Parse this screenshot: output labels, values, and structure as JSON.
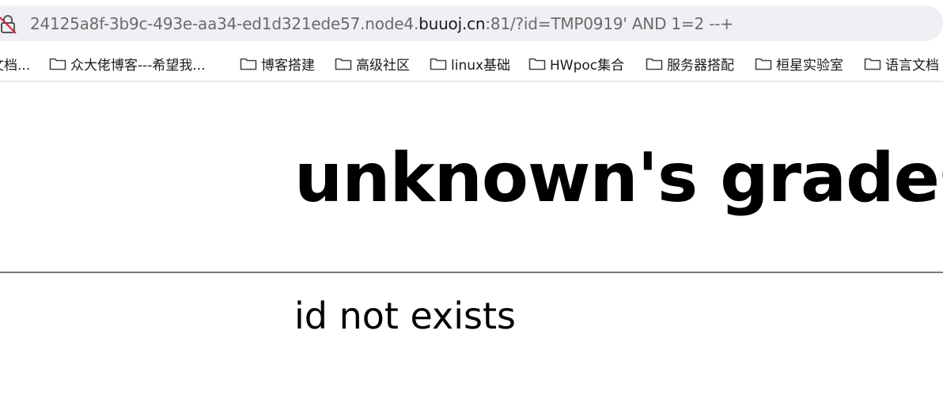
{
  "browser": {
    "url_prefix": "24125a8f-3b9c-493e-aa34-ed1d321ede57.node4.",
    "url_domain": "buuoj.cn",
    "url_suffix": ":81/?id=TMP0919' AND 1=2 --+",
    "lock_icon": "insecure-lock-icon"
  },
  "bookmarks": [
    {
      "label": "文档..."
    },
    {
      "label": "众大佬博客---希望我..."
    },
    {
      "label": "博客搭建"
    },
    {
      "label": "高级社区"
    },
    {
      "label": "linux基础"
    },
    {
      "label": "HWpoc集合"
    },
    {
      "label": "服务器搭配"
    },
    {
      "label": "桓星实验室"
    },
    {
      "label": "语言文档"
    }
  ],
  "page": {
    "title": "unknown's grades",
    "message": "id not exists"
  }
}
